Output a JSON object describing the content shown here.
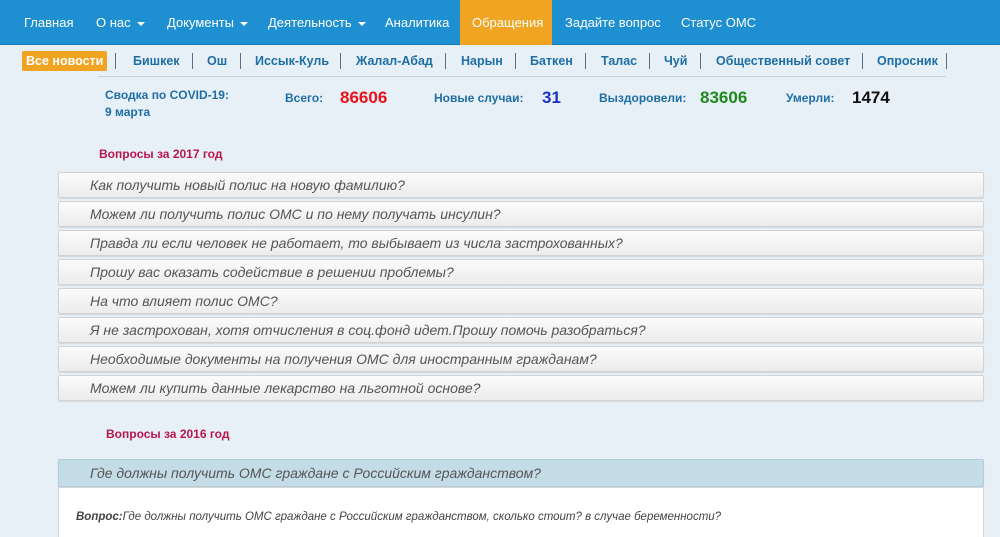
{
  "nav": {
    "items": [
      {
        "label": "Главная",
        "dropdown": false,
        "active": false
      },
      {
        "label": "О нас",
        "dropdown": true,
        "active": false
      },
      {
        "label": "Документы",
        "dropdown": true,
        "active": false
      },
      {
        "label": "Деятельность",
        "dropdown": true,
        "active": false
      },
      {
        "label": "Аналитика",
        "dropdown": false,
        "active": false
      },
      {
        "label": "Обращения",
        "dropdown": false,
        "active": true
      },
      {
        "label": "Задайте вопрос",
        "dropdown": false,
        "active": false
      },
      {
        "label": "Статус ОМС",
        "dropdown": false,
        "active": false
      }
    ]
  },
  "regions": [
    {
      "label": "Все новости",
      "active": true
    },
    {
      "label": "Бишкек",
      "active": false
    },
    {
      "label": "Ош",
      "active": false
    },
    {
      "label": "Иссык-Куль",
      "active": false
    },
    {
      "label": "Жалал-Абад",
      "active": false
    },
    {
      "label": "Нарын",
      "active": false
    },
    {
      "label": "Баткен",
      "active": false
    },
    {
      "label": "Талас",
      "active": false
    },
    {
      "label": "Чуй",
      "active": false
    },
    {
      "label": "Общественный совет",
      "active": false
    },
    {
      "label": "Опросник",
      "active": false
    }
  ],
  "covid": {
    "title": "Сводка по COVID-19:",
    "date": "9 марта",
    "total_label": "Всего:",
    "total_value": "86606",
    "new_label": "Новые случаи:",
    "new_value": "31",
    "recovered_label": "Выздоровели:",
    "recovered_value": "83606",
    "deaths_label": "Умерли:",
    "deaths_value": "1474"
  },
  "sections": [
    {
      "title": "Вопросы за 2017 год",
      "questions": [
        "Как получить новый полис на новую фамилию?",
        "Можем ли получить полис ОМС и по нему получать инсулин?",
        "Правда ли если человек не работает, то выбывает из числа застрохованных?",
        "Прошу вас оказать содействие в решении проблемы?",
        "На что влияет полис ОМС?",
        "Я не застрохован, хотя отчисления в соц.фонд идет.Прошу помочь разобраться?",
        "Необходимые документы на получения ОМС для иностранным гражданам?",
        "Можем ли купить данные лекарство на льготной основе?"
      ]
    },
    {
      "title": "Вопросы за 2016 год",
      "questions": [
        "Где должны получить ОМС граждане с Российским гражданством?"
      ]
    }
  ],
  "answer": {
    "label": "Вопрос:",
    "text": "Где должны получить ОМС граждане с Российским гражданством, сколько стоит? в случае беременности?"
  },
  "colors": {
    "nav_bg": "#1e8fd0",
    "accent": "#f0a422",
    "link": "#1e6ea6",
    "section_title": "#b8174c",
    "total_value": "#e8121b",
    "new_value": "#1a2fc8",
    "recovered_value": "#1e8a1e",
    "deaths_value": "#111111"
  }
}
